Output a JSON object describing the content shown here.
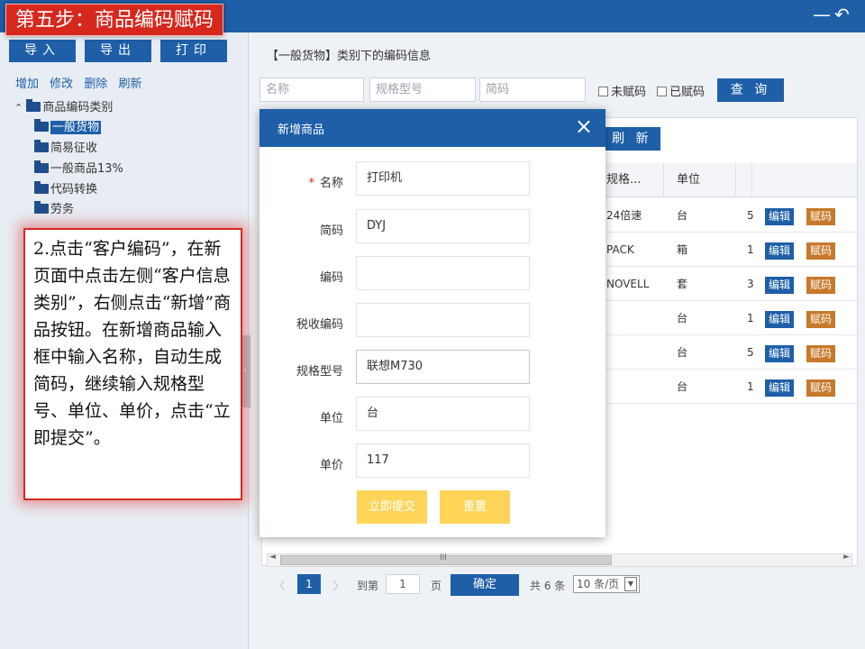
{
  "window": {
    "minimize_icon": "minimize-icon",
    "back_icon": "back-arrow-icon"
  },
  "step_title": "第五步：商品编码赋码",
  "sidebar": {
    "toolbar": {
      "import_label": "导入",
      "export_label": "导出",
      "print_label": "打印"
    },
    "actions": {
      "add": "增加",
      "modify": "修改",
      "delete": "删除",
      "refresh": "刷新"
    },
    "tree": {
      "root": "商品编码类别",
      "children": [
        "一般货物",
        "简易征收",
        "一般商品13%",
        "代码转换",
        "劳务"
      ],
      "selected": "一般货物"
    }
  },
  "main": {
    "crumb": "【一般货物】类别下的编码信息",
    "filters": {
      "name_placeholder": "名称",
      "spec_placeholder": "规格型号",
      "short_placeholder": "简码"
    },
    "checkbox_unassigned": "未赋码",
    "checkbox_assigned": "已赋码",
    "query_label": "查 询",
    "refresh_label": "刷 新",
    "columns": [
      "规格...",
      "单位"
    ],
    "rows": [
      {
        "spec": "24倍速",
        "unit": "台",
        "extra": "5"
      },
      {
        "spec": "PACK",
        "unit": "箱",
        "extra": "1"
      },
      {
        "spec": "NOVELL",
        "unit": "套",
        "extra": "3"
      },
      {
        "spec": "",
        "unit": "台",
        "extra": "1"
      },
      {
        "spec": "",
        "unit": "台",
        "extra": "5"
      },
      {
        "spec": "",
        "unit": "台",
        "extra": "1"
      }
    ],
    "row_edit": "编辑",
    "row_assign": "赋码",
    "scroll_grip": "III",
    "pager": {
      "prev": "〈",
      "current": "1",
      "next": "〉",
      "goto_label": "到第",
      "goto_value": "1",
      "page_label": "页",
      "confirm": "确定",
      "total": "共 6 条",
      "page_size": "10 条/页"
    }
  },
  "note": "2.点击“客户编码”，在新页面中点击左侧“客户信息类别”，右侧点击“新增”商品按钮。在新增商品输入框中输入名称，自动生成简码，继续输入规格型号、单位、单价，点击“立即提交”。",
  "modal": {
    "title": "新增商品",
    "close": "×",
    "fields": {
      "name_label": "名称",
      "name_required": "*",
      "name_value": "打印机",
      "short_label": "简码",
      "short_value": "DYJ",
      "code_label": "编码",
      "code_value": "",
      "tax_label": "税收编码",
      "tax_value": "",
      "spec_label": "规格型号",
      "spec_value": "联想M730",
      "unit_label": "单位",
      "unit_value": "台",
      "price_label": "单价",
      "price_value": "117"
    },
    "submit_label": "立即提交",
    "reset_label": "重置"
  }
}
